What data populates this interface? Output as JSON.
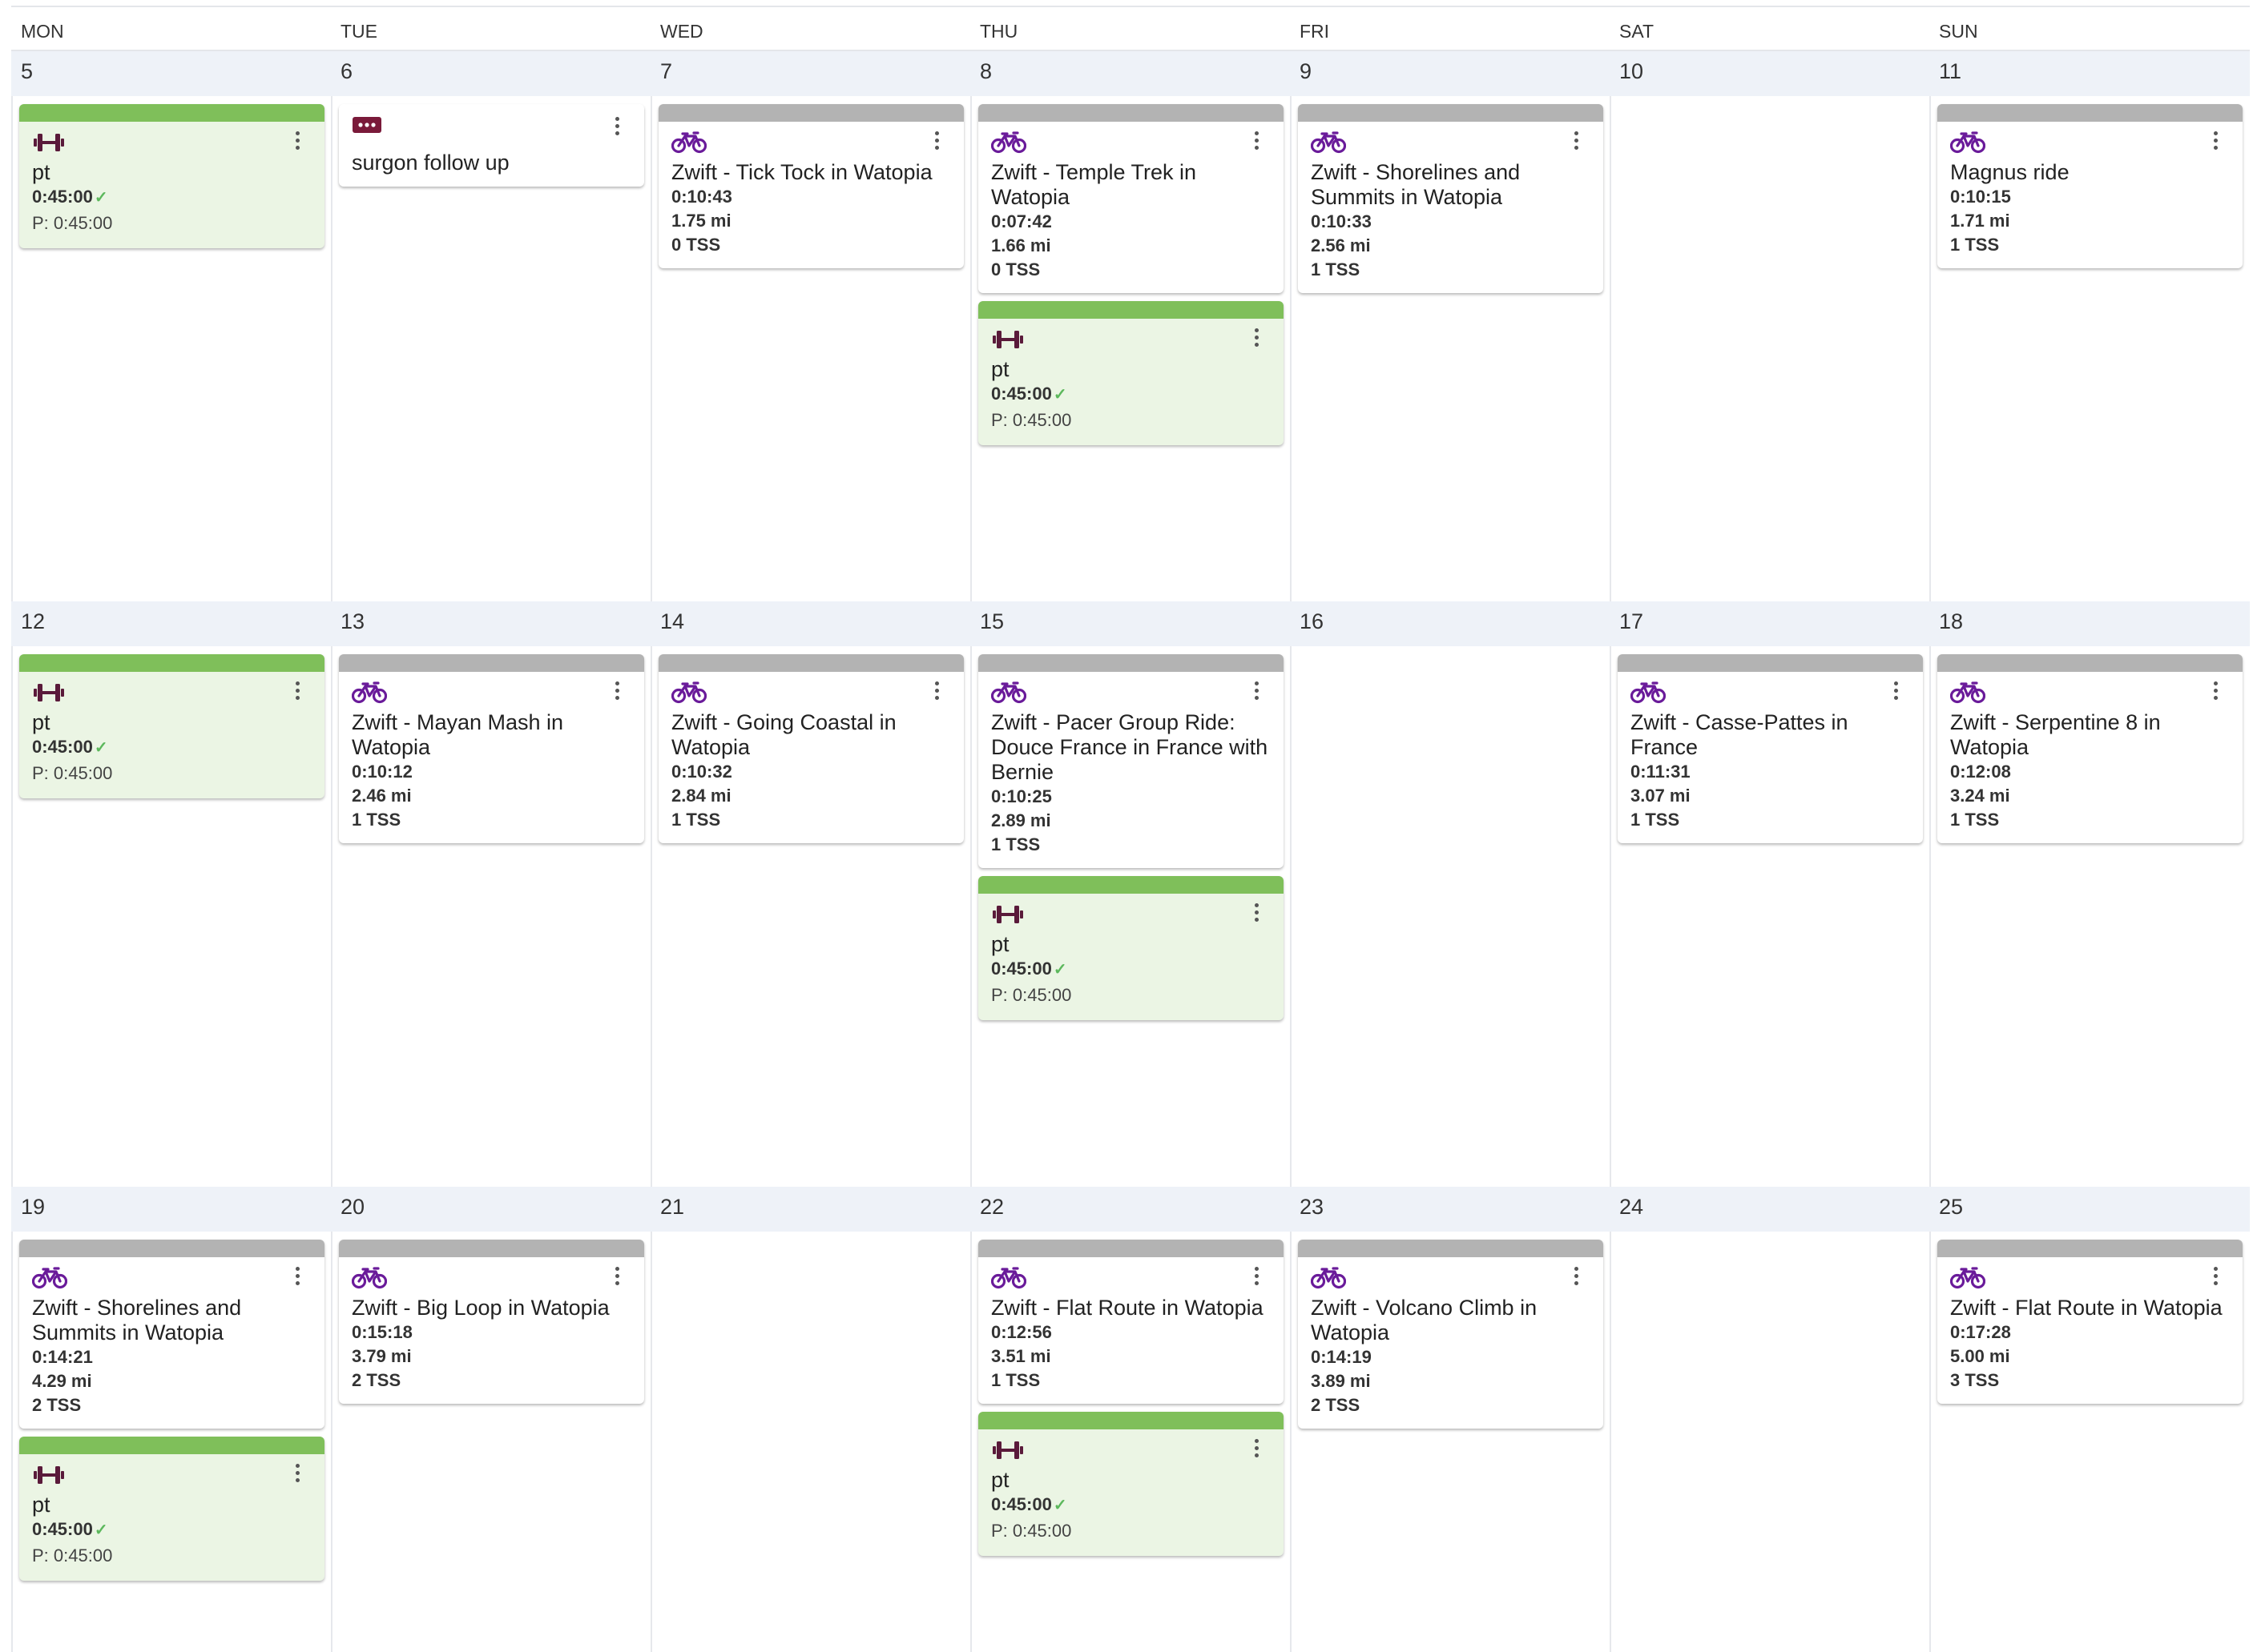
{
  "colors": {
    "ride_bar": "#b3b3b3",
    "strength_bar": "#7fbf5a",
    "strength_bg": "#ebf5e4",
    "bike_icon": "#6a1b9a",
    "strength_icon": "#5a1a3a",
    "note_icon": "#7a1a3a",
    "check": "#5cb85c"
  },
  "weekdays": [
    "MON",
    "TUE",
    "WED",
    "THU",
    "FRI",
    "SAT",
    "SUN"
  ],
  "weeks": [
    {
      "dates": [
        "5",
        "6",
        "7",
        "8",
        "9",
        "10",
        "11"
      ],
      "days": [
        [
          {
            "type": "strength",
            "title": "pt",
            "duration": "0:45:00",
            "planned": "P: 0:45:00"
          }
        ],
        [
          {
            "type": "note",
            "title": "surgon follow up"
          }
        ],
        [
          {
            "type": "ride",
            "title": "Zwift - Tick Tock in Watopia",
            "duration": "0:10:43",
            "distance": "1.75 mi",
            "tss": "0 TSS"
          }
        ],
        [
          {
            "type": "ride",
            "title": "Zwift - Temple Trek in Watopia",
            "duration": "0:07:42",
            "distance": "1.66 mi",
            "tss": "0 TSS"
          },
          {
            "type": "strength",
            "title": "pt",
            "duration": "0:45:00",
            "planned": "P: 0:45:00"
          }
        ],
        [
          {
            "type": "ride",
            "title": "Zwift - Shorelines and Summits in Watopia",
            "duration": "0:10:33",
            "distance": "2.56 mi",
            "tss": "1 TSS"
          }
        ],
        [],
        [
          {
            "type": "ride",
            "title": "Magnus ride",
            "duration": "0:10:15",
            "distance": "1.71 mi",
            "tss": "1 TSS"
          }
        ]
      ]
    },
    {
      "dates": [
        "12",
        "13",
        "14",
        "15",
        "16",
        "17",
        "18"
      ],
      "days": [
        [
          {
            "type": "strength",
            "title": "pt",
            "duration": "0:45:00",
            "planned": "P: 0:45:00"
          }
        ],
        [
          {
            "type": "ride",
            "title": "Zwift - Mayan Mash in Watopia",
            "duration": "0:10:12",
            "distance": "2.46 mi",
            "tss": "1 TSS"
          }
        ],
        [
          {
            "type": "ride",
            "title": "Zwift - Going Coastal in Watopia",
            "duration": "0:10:32",
            "distance": "2.84 mi",
            "tss": "1 TSS"
          }
        ],
        [
          {
            "type": "ride",
            "title": "Zwift - Pacer Group Ride: Douce France in France with Bernie",
            "duration": "0:10:25",
            "distance": "2.89 mi",
            "tss": "1 TSS"
          },
          {
            "type": "strength",
            "title": "pt",
            "duration": "0:45:00",
            "planned": "P: 0:45:00"
          }
        ],
        [],
        [
          {
            "type": "ride",
            "title": "Zwift - Casse-Pattes in France",
            "duration": "0:11:31",
            "distance": "3.07 mi",
            "tss": "1 TSS"
          }
        ],
        [
          {
            "type": "ride",
            "title": "Zwift - Serpentine 8 in Watopia",
            "duration": "0:12:08",
            "distance": "3.24 mi",
            "tss": "1 TSS"
          }
        ]
      ]
    },
    {
      "dates": [
        "19",
        "20",
        "21",
        "22",
        "23",
        "24",
        "25"
      ],
      "days": [
        [
          {
            "type": "ride",
            "title": "Zwift - Shorelines and Summits in Watopia",
            "duration": "0:14:21",
            "distance": "4.29 mi",
            "tss": "2 TSS"
          },
          {
            "type": "strength",
            "title": "pt",
            "duration": "0:45:00",
            "planned": "P: 0:45:00"
          }
        ],
        [
          {
            "type": "ride",
            "title": "Zwift - Big Loop in Watopia",
            "duration": "0:15:18",
            "distance": "3.79 mi",
            "tss": "2 TSS"
          }
        ],
        [],
        [
          {
            "type": "ride",
            "title": "Zwift - Flat Route in Watopia",
            "duration": "0:12:56",
            "distance": "3.51 mi",
            "tss": "1 TSS"
          },
          {
            "type": "strength",
            "title": "pt",
            "duration": "0:45:00",
            "planned": "P: 0:45:00"
          }
        ],
        [
          {
            "type": "ride",
            "title": "Zwift - Volcano Climb in Watopia",
            "duration": "0:14:19",
            "distance": "3.89 mi",
            "tss": "2 TSS"
          }
        ],
        [],
        [
          {
            "type": "ride",
            "title": "Zwift - Flat Route in Watopia",
            "duration": "0:17:28",
            "distance": "5.00 mi",
            "tss": "3 TSS"
          }
        ]
      ]
    }
  ]
}
